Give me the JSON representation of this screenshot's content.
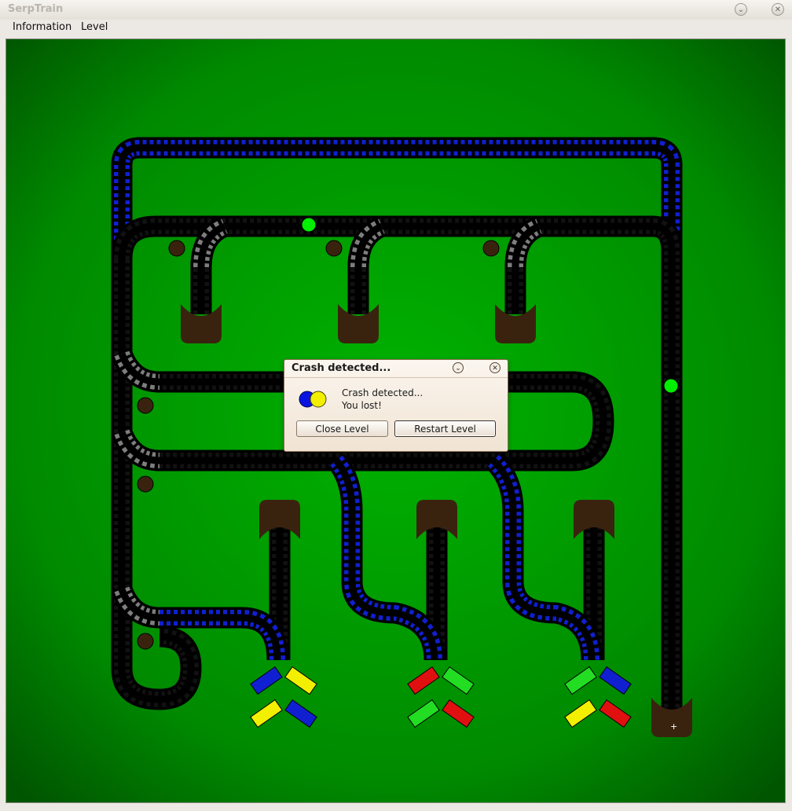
{
  "window": {
    "title": "SerpTrain",
    "minimize_icon": "chevron-down-icon",
    "close_icon": "close-icon"
  },
  "menu": {
    "information": "Information",
    "level": "Level"
  },
  "colors": {
    "board_center": "#00b000",
    "board_edge": "#005000",
    "rail": "#000000",
    "blue_wagon": "#1020d0",
    "gray_switch": "#7e7e7e",
    "station": "#3a230e",
    "signal_green": "#00ee00"
  },
  "status": {
    "cursor_mark": "+"
  },
  "dialog": {
    "title": "Crash detected...",
    "message_line1": "Crash detected...",
    "message_line2": "You lost!",
    "close_button": "Close Level",
    "restart_button": "Restart Level",
    "icon": "crash-balls-icon",
    "ball_colors": [
      "#0a14e0",
      "#f3ef00"
    ]
  }
}
